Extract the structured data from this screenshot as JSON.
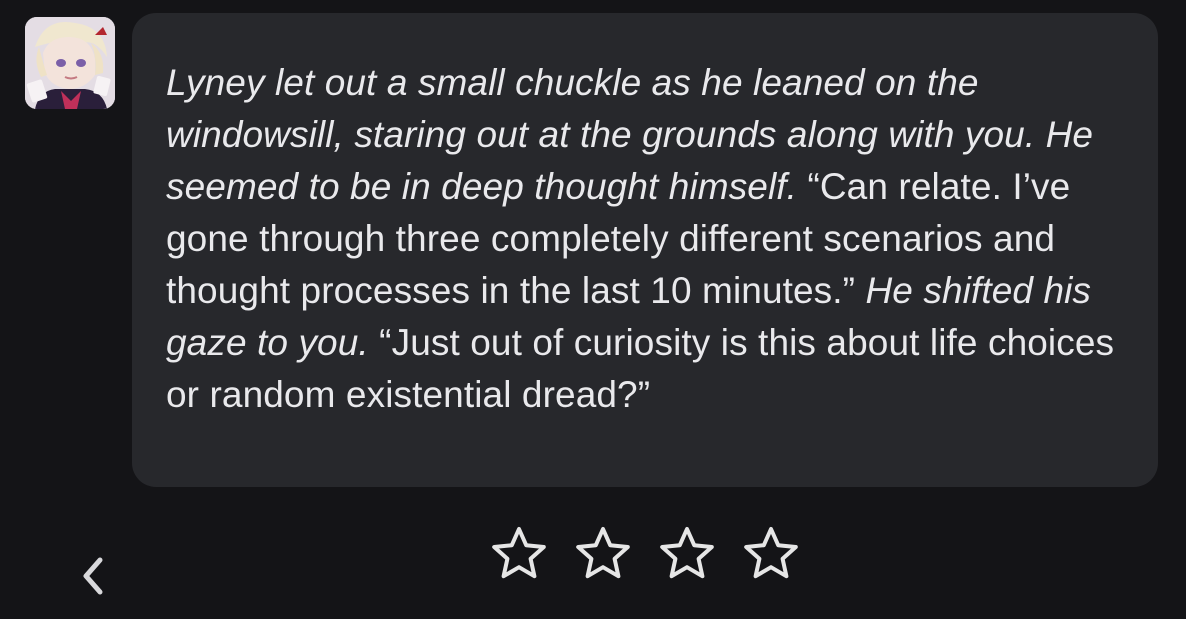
{
  "message": {
    "segments": [
      {
        "style": "action",
        "text": "Lyney let out a small chuckle as he leaned on the windowsill, staring out at the grounds along with you. He seemed to be in deep thought himself. "
      },
      {
        "style": "speech",
        "text": "“Can relate. I’ve gone through three completely different scenarios and thought processes in the last 10 minutes.” "
      },
      {
        "style": "action",
        "text": "He shifted his gaze to you. "
      },
      {
        "style": "speech",
        "text": "“Just out of curiosity is this about life choices or random existential dread?”"
      }
    ]
  },
  "avatar": {
    "icon": "character-avatar"
  },
  "navigation": {
    "back_icon": "chevron-left-icon"
  },
  "rating": {
    "max_stars": 4,
    "selected": 0,
    "star_icon": "star-outline-icon"
  },
  "colors": {
    "background": "#141417",
    "bubble": "#27282c",
    "text": "#e9e9ec",
    "icon": "#e6e6e6"
  }
}
